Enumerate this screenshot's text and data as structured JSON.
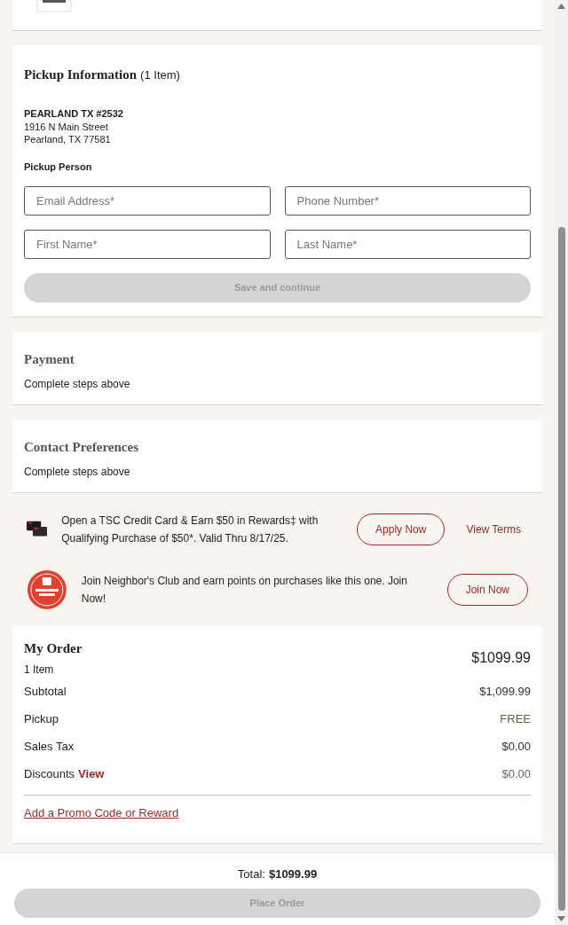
{
  "pickup": {
    "title": "Pickup Information",
    "count": "(1 Item)",
    "store": "PEARLAND TX #2532",
    "address": [
      "1916 N Main Street",
      "Pearland, TX 77581"
    ],
    "person_label": "Pickup Person",
    "fields": [
      {
        "placeholder": "Email Address*"
      },
      {
        "placeholder": "Phone Number*"
      },
      {
        "placeholder": "First Name*"
      },
      {
        "placeholder": "Last Name*"
      }
    ],
    "save_button": {
      "label": "Save and continue",
      "disabled": true
    }
  },
  "steps": [
    {
      "title": "Payment",
      "note": "Complete steps above"
    },
    {
      "title": "Contact Preferences",
      "note": "Complete steps above"
    }
  ],
  "offers": [
    {
      "kind": "credit",
      "text": "Open a TSC Credit Card & Earn $50 in Rewards‡ with Qualifying Purchase of $50*. Valid Thru 8/17/25.",
      "button": "Apply Now",
      "link": "View Terms"
    },
    {
      "kind": "club",
      "text": "Join Neighbor's Club and earn points on purchases like this one. Join Now!",
      "button": "Join Now"
    }
  ],
  "order": {
    "title": "My Order",
    "count": "1 Item",
    "total": "$1099.99",
    "lines": [
      {
        "label": "Subtotal",
        "value": "$1,099.99",
        "kind": "amount"
      },
      {
        "label": "Pickup",
        "value": "FREE",
        "kind": "free"
      },
      {
        "label": "Sales Tax",
        "value": "$0.00",
        "kind": "amount"
      },
      {
        "label": "Discounts",
        "link": "View",
        "value": "$0.00",
        "kind": "muted"
      }
    ],
    "promo_link": "Add a Promo Code or Reward"
  },
  "footer": {
    "total_label": "Total:",
    "total_value": "$1099.99",
    "button": {
      "label": "Place Order",
      "disabled": true
    }
  }
}
